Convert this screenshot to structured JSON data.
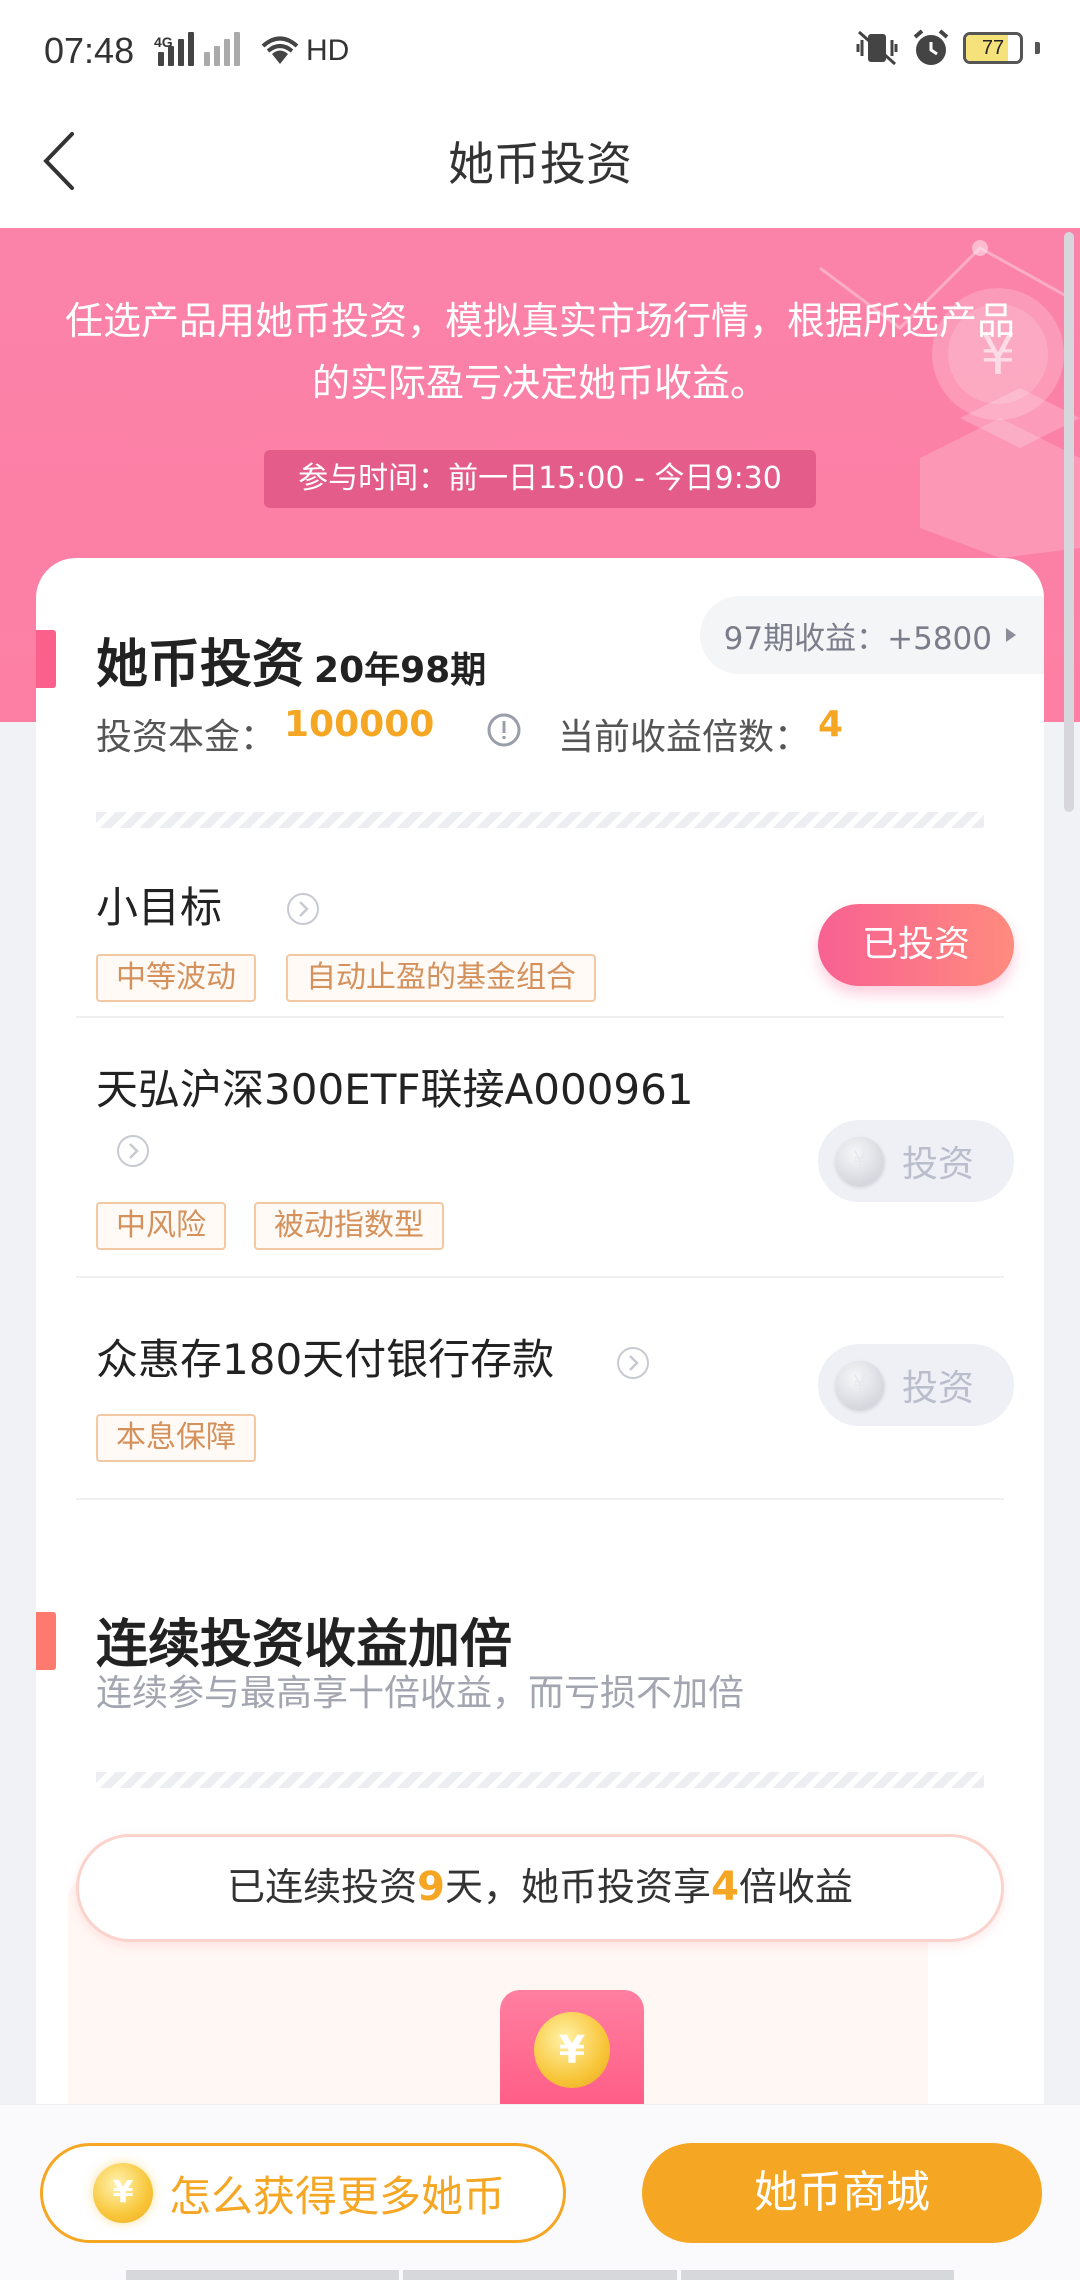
{
  "status_bar": {
    "time": "07:48",
    "network_type": "4G",
    "hd_label": "HD",
    "battery": "77",
    "battery_level_percent": 77
  },
  "nav": {
    "title": "她币投资"
  },
  "banner": {
    "description": "任选产品用她币投资，模拟真实市场行情，根据所选产品的实际盈亏决定她币收益。",
    "time_label": "参与时间：前一日15:00 - 今日9:30"
  },
  "invest_section": {
    "title": "她币投资",
    "issue": "20年98期",
    "prev_earnings": "97期收益：+5800",
    "principal_label": "投资本金：",
    "principal_value": "100000",
    "multiplier_label": "当前收益倍数：",
    "multiplier_value": "4"
  },
  "products": [
    {
      "name": "小目标",
      "tags": [
        "中等波动",
        "自动止盈的基金组合"
      ],
      "button": "已投资",
      "invested": true
    },
    {
      "name": "天弘沪深300ETF联接A000961",
      "tags": [
        "中风险",
        "被动指数型"
      ],
      "button": "投资",
      "invested": false
    },
    {
      "name": "众惠存180天付银行存款",
      "tags": [
        "本息保障"
      ],
      "button": "投资",
      "invested": false
    }
  ],
  "streak_section": {
    "title": "连续投资收益加倍",
    "subtitle": "连续参与最高享十倍收益，而亏损不加倍",
    "pill_prefix": "已连续投资",
    "days": "9",
    "pill_middle": "天，她币投资享",
    "multiplier": "4",
    "pill_suffix": "倍收益"
  },
  "bottom_bar": {
    "how_label": "怎么获得更多她币",
    "mall_label": "她币商城"
  },
  "icons": {
    "coin_symbol": "¥"
  },
  "colors": {
    "banner_pink": "#fb82a9",
    "accent_orange": "#f5a623",
    "invested_gradient_start": "#f86193",
    "invested_gradient_end": "#ff8b7e"
  }
}
